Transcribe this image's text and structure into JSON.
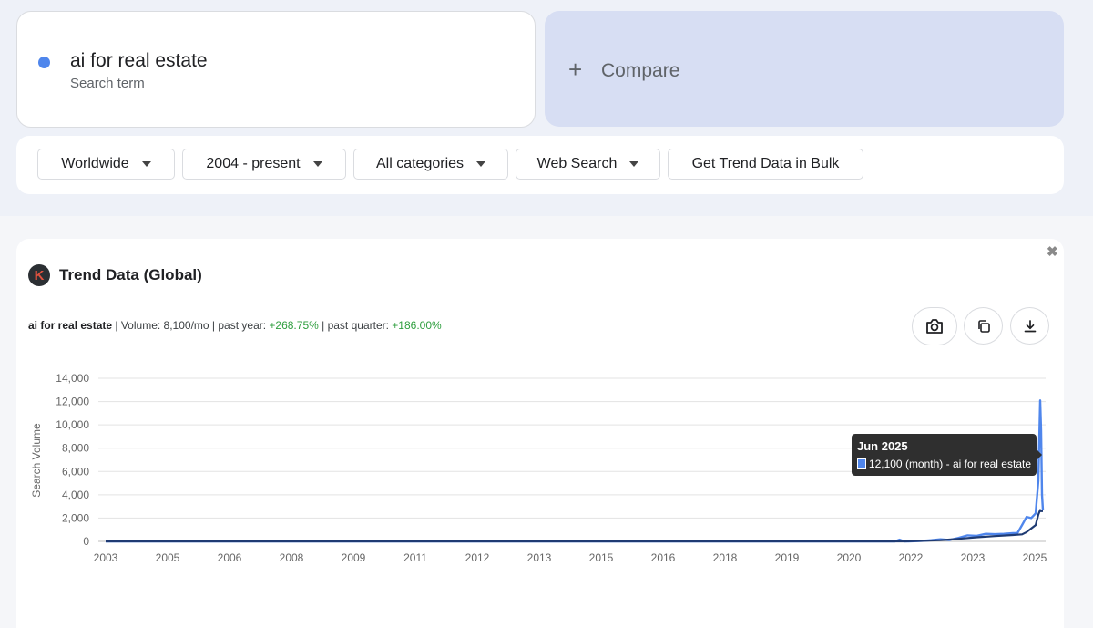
{
  "search": {
    "term": "ai for real estate",
    "term_label": "Search term",
    "term_color": "#4f86ec"
  },
  "compare": {
    "icon": "plus-icon",
    "label": "Compare"
  },
  "filters": {
    "region": "Worldwide",
    "range": "2004 - present",
    "category": "All categories",
    "type": "Web Search",
    "bulk": "Get Trend Data in Bulk"
  },
  "panel": {
    "title": "Trend Data (Global)",
    "logo_letter": "K",
    "close_icon": "close-icon",
    "stats": {
      "keyword": "ai for real estate",
      "volume_label": "| Volume: ",
      "volume": "8,100/mo",
      "year_label": " | past year: ",
      "year_change": "+268.75%",
      "quarter_label": " | past quarter: ",
      "quarter_change": "+186.00%"
    },
    "tools": [
      "camera-icon",
      "copy-icon",
      "download-icon"
    ]
  },
  "chart_data": {
    "type": "line",
    "ylabel": "Search Volume",
    "ylim": [
      0,
      14000
    ],
    "yticks": [
      0,
      2000,
      4000,
      6000,
      8000,
      10000,
      12000,
      14000
    ],
    "ytick_labels": [
      "0",
      "2,000",
      "4,000",
      "6,000",
      "8,000",
      "10,000",
      "12,000",
      "14,000"
    ],
    "xtick_labels": [
      "2003",
      "2005",
      "2006",
      "2008",
      "2009",
      "2011",
      "2012",
      "2013",
      "2015",
      "2016",
      "2018",
      "2019",
      "2020",
      "2022",
      "2023",
      "2025"
    ],
    "grid": true,
    "series": [
      {
        "color": "#4f86ec",
        "x": [
          0,
          870,
          875,
          880,
          885,
          900,
          910,
          920,
          930,
          940,
          950,
          960,
          970,
          980,
          990,
          1000,
          1005,
          1010,
          1015,
          1020,
          1025,
          1028,
          1030,
          1031,
          1032,
          1033
        ],
        "values": [
          0,
          0,
          150,
          0,
          0,
          50,
          100,
          180,
          120,
          300,
          520,
          480,
          650,
          620,
          650,
          700,
          720,
          1400,
          2100,
          2000,
          2400,
          5200,
          12100,
          9500,
          4000,
          2700
        ]
      },
      {
        "color": "#1f3b73",
        "x": [
          0,
          880,
          900,
          920,
          940,
          960,
          980,
          1000,
          1010,
          1015,
          1020,
          1025,
          1028,
          1030,
          1031,
          1033
        ],
        "values": [
          0,
          0,
          50,
          100,
          220,
          350,
          450,
          550,
          600,
          800,
          1100,
          1400,
          2300,
          2700,
          2600,
          2600
        ]
      }
    ]
  },
  "tooltip": {
    "title": "Jun 2025",
    "line": "12,100 (month) - ai for real estate"
  }
}
